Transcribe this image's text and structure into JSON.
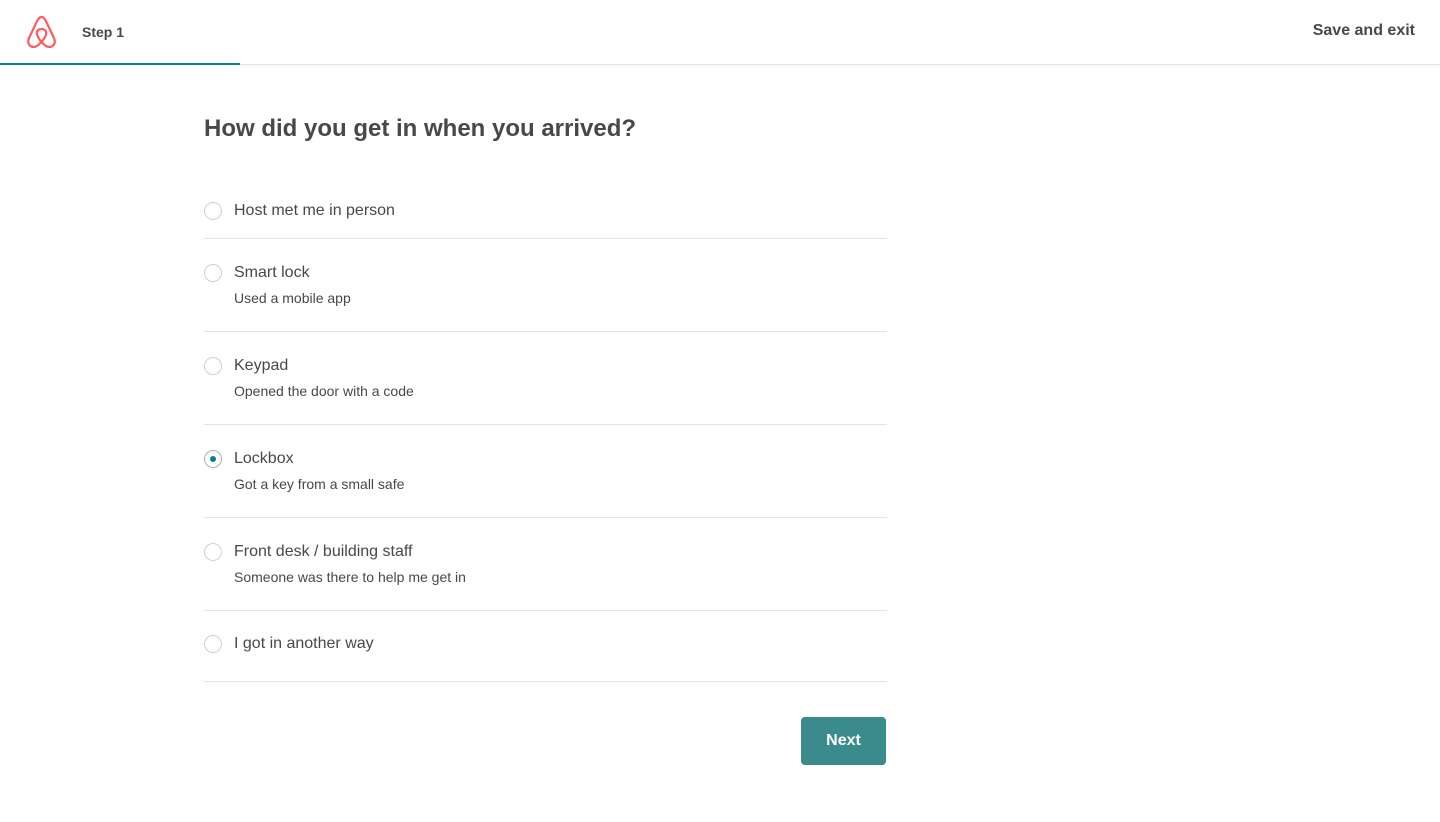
{
  "header": {
    "step_label": "Step 1",
    "save_exit_label": "Save and exit",
    "progress_fraction": 0.1667,
    "logo_icon": "airbnb-logo-icon",
    "brand_color": "#FF5A5F"
  },
  "main": {
    "question": "How did you get in when you arrived?",
    "options": [
      {
        "title": "Host met me in person",
        "subtitle": "",
        "selected": false
      },
      {
        "title": "Smart lock",
        "subtitle": "Used a mobile app",
        "selected": false
      },
      {
        "title": "Keypad",
        "subtitle": "Opened the door with a code",
        "selected": false
      },
      {
        "title": "Lockbox",
        "subtitle": "Got a key from a small safe",
        "selected": true
      },
      {
        "title": "Front desk / building staff",
        "subtitle": "Someone was there to help me get in",
        "selected": false
      },
      {
        "title": "I got in another way",
        "subtitle": "",
        "selected": false
      }
    ],
    "next_label": "Next"
  },
  "colors": {
    "accent": "#008489",
    "button": "#3C8B8C",
    "text": "#484848"
  }
}
